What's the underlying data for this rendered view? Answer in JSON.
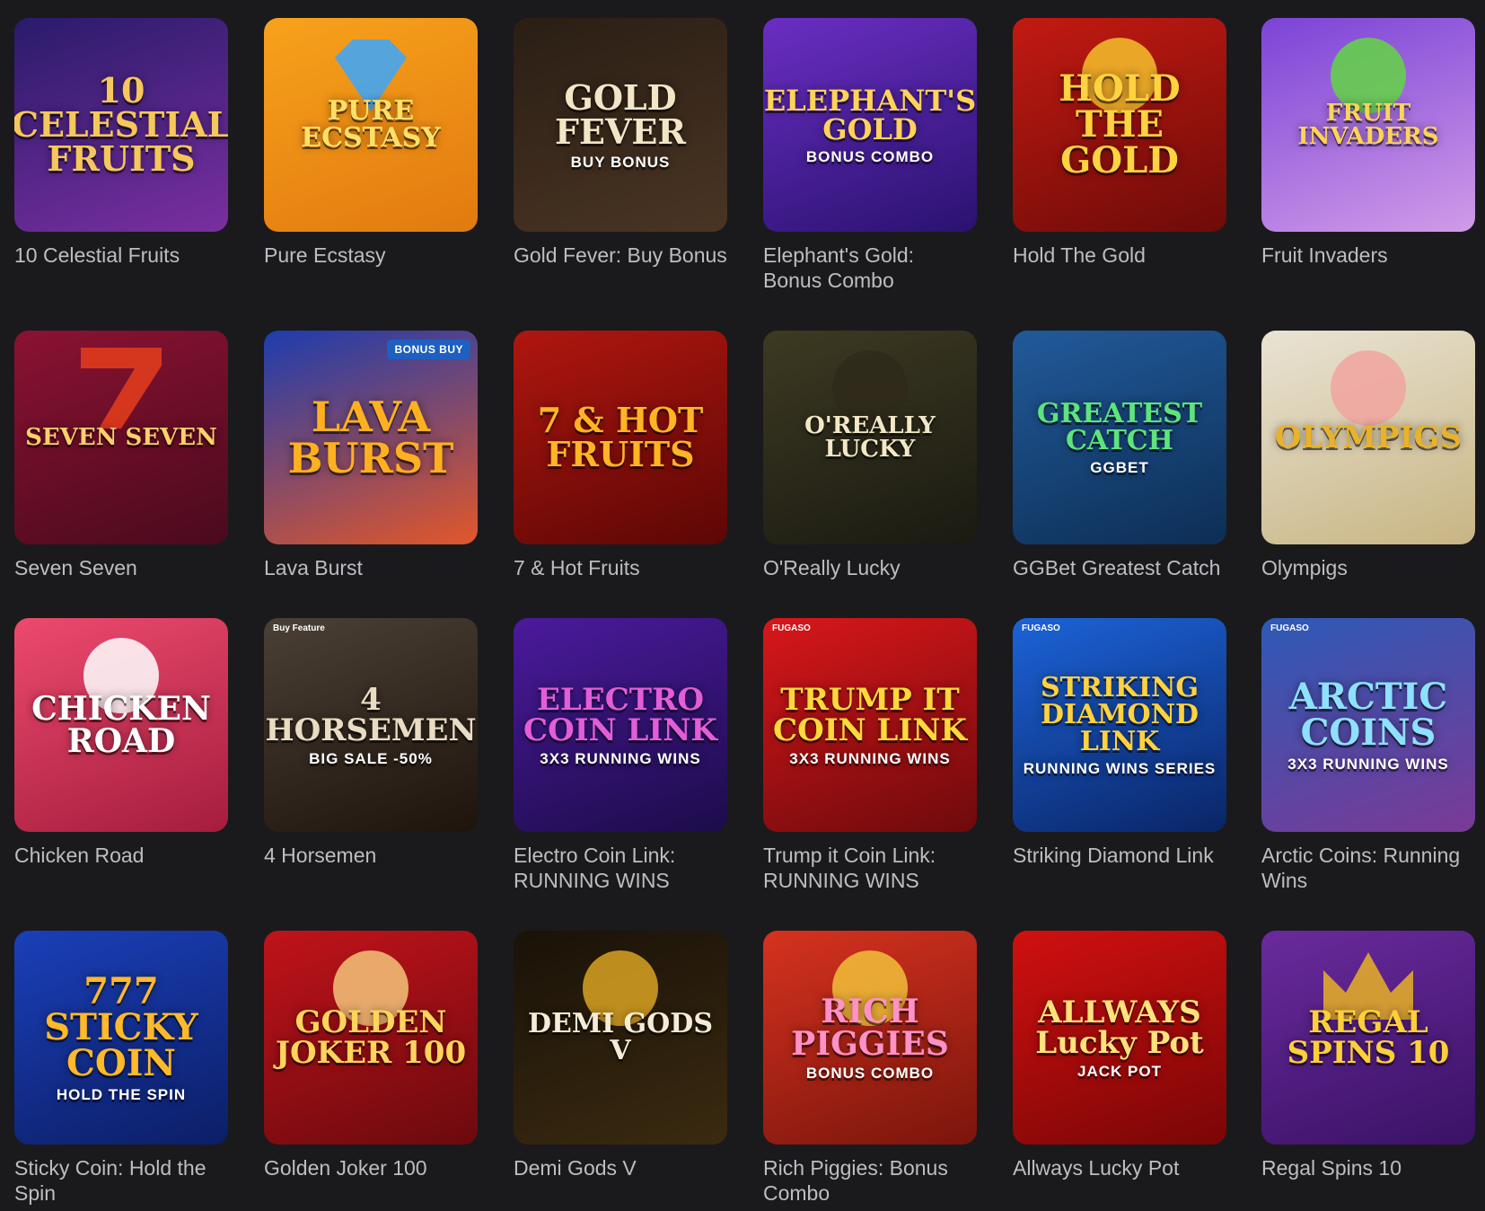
{
  "games": [
    {
      "name": "10 Celestial Fruits",
      "art_text": "10 CELESTIAL FRUITS",
      "bg": [
        "#2a1b6b",
        "#7a2fa0"
      ],
      "text_color": "#f6c75a",
      "art_size": 38
    },
    {
      "name": "Pure Ecstasy",
      "art_text": "PURE ECSTASY",
      "bg": [
        "#f7a21c",
        "#e27a0f"
      ],
      "text_color": "#ffe066",
      "art_size": 30,
      "icon": "diamond-icon",
      "icon_color": "#3aa7ff"
    },
    {
      "name": "Gold Fever: Buy Bonus",
      "art_text": "GOLD FEVER",
      "art_sub": "BUY BONUS",
      "bg": [
        "#2a1e14",
        "#4a3524"
      ],
      "text_color": "#f2e6c6",
      "art_size": 38
    },
    {
      "name": "Elephant's Gold: Bonus Combo",
      "art_text": "ELEPHANT'S GOLD",
      "art_sub": "BONUS COMBO",
      "bg": [
        "#6a2ec2",
        "#2a1270"
      ],
      "text_color": "#ffd25a",
      "art_size": 32
    },
    {
      "name": "Hold The Gold",
      "art_text": "HOLD THE GOLD",
      "bg": [
        "#c21a12",
        "#6e0b08"
      ],
      "text_color": "#ffd23f",
      "art_size": 40,
      "icon": "question-coin-icon",
      "icon_color": "#f5c02c"
    },
    {
      "name": "Fruit Invaders",
      "art_text": "FRUIT INVADERS",
      "bg": [
        "#7b43d6",
        "#d19be8"
      ],
      "text_color": "#ffd35a",
      "art_size": 26,
      "icon": "monster-icon",
      "icon_color": "#63d645"
    },
    {
      "name": "Seven Seven",
      "art_text": "SEVEN SEVEN",
      "bg": [
        "#8a1232",
        "#4a0a1d"
      ],
      "text_color": "#ffcf6b",
      "art_size": 26,
      "icon": "seven-icon",
      "icon_color": "#e63d1c"
    },
    {
      "name": "Lava Burst",
      "art_text": "LAVA BURST",
      "bg": [
        "#1d3cae",
        "#e2572a"
      ],
      "text_color": "#ffb020",
      "art_size": 46,
      "badge": "BONUS BUY"
    },
    {
      "name": "7 & Hot Fruits",
      "art_text": "7 & HOT FRUITS",
      "bg": [
        "#b0160f",
        "#5c0705"
      ],
      "text_color": "#ffb423",
      "art_size": 38
    },
    {
      "name": "O'Really Lucky",
      "art_text": "O'REALLY LUCKY",
      "bg": [
        "#3d3a22",
        "#1a1a12"
      ],
      "text_color": "#f3e8c6",
      "art_size": 26,
      "icon": "leprechaun-icon",
      "icon_color": "#2f2a1a"
    },
    {
      "name": "GGBet Greatest Catch",
      "art_text": "GREATEST CATCH",
      "art_sub": "GGBET",
      "bg": [
        "#215a9a",
        "#0d2e55"
      ],
      "text_color": "#5ee37d",
      "art_size": 30
    },
    {
      "name": "Olympigs",
      "art_text": "OLYMPIGS",
      "bg": [
        "#e9e3d4",
        "#c8b583"
      ],
      "text_color": "#e8b22b",
      "art_size": 34,
      "icon": "pig-icon",
      "icon_color": "#f2a5a0"
    },
    {
      "name": "Chicken Road",
      "art_text": "CHICKEN ROAD",
      "bg": [
        "#ec4a6d",
        "#a51d3e"
      ],
      "text_color": "#ffffff",
      "art_size": 36,
      "icon": "chicken-icon",
      "icon_color": "#ffffff"
    },
    {
      "name": "4 Horsemen",
      "art_text": "4 HORSEMEN",
      "art_sub": "BIG SALE -50%",
      "bg": [
        "#4a4036",
        "#1e140c"
      ],
      "text_color": "#e8dcc3",
      "art_size": 34,
      "provider": "Buy Feature"
    },
    {
      "name": "Electro Coin Link: RUNNING WINS",
      "art_text": "ELECTRO COIN LINK",
      "art_sub": "3X3 RUNNING WINS",
      "bg": [
        "#4b1a9c",
        "#1c0c4a"
      ],
      "text_color": "#e25ed8",
      "art_size": 34
    },
    {
      "name": "Trump it Coin Link: RUNNING WINS",
      "art_text": "TRUMP IT COIN LINK",
      "art_sub": "3X3 RUNNING WINS",
      "bg": [
        "#d8171a",
        "#6e0a0c"
      ],
      "text_color": "#ffd93a",
      "art_size": 34,
      "provider": "FUGASO"
    },
    {
      "name": "Striking Diamond Link",
      "art_text": "STRIKING DIAMOND LINK",
      "art_sub": "RUNNING WINS SERIES",
      "bg": [
        "#1c63d8",
        "#0a2566"
      ],
      "text_color": "#ffd23f",
      "art_size": 30,
      "provider": "FUGASO"
    },
    {
      "name": "Arctic Coins: Running Wins",
      "art_text": "ARCTIC COINS",
      "art_sub": "3X3 RUNNING WINS",
      "bg": [
        "#2d5ab6",
        "#7a3a96"
      ],
      "text_color": "#8ee0ff",
      "art_size": 40,
      "provider": "FUGASO"
    },
    {
      "name": "Sticky Coin: Hold the Spin",
      "art_text": "777 STICKY COIN",
      "art_sub": "HOLD THE SPIN",
      "bg": [
        "#1a3fb8",
        "#0c1e66"
      ],
      "text_color": "#ffb92a",
      "art_size": 40
    },
    {
      "name": "Golden Joker 100",
      "art_text": "GOLDEN JOKER 100",
      "bg": [
        "#c0131a",
        "#6b0a0e"
      ],
      "text_color": "#ffd45a",
      "art_size": 34,
      "icon": "joker-icon",
      "icon_color": "#f5c47a"
    },
    {
      "name": "Demi Gods V",
      "art_text": "DEMI GODS V",
      "bg": [
        "#1a1208",
        "#3a2a10"
      ],
      "text_color": "#f4ecd6",
      "art_size": 30,
      "icon": "gold-coin-icon",
      "icon_color": "#d9a322"
    },
    {
      "name": "Rich Piggies: Bonus Combo",
      "art_text": "RICH PIGGIES",
      "art_sub": "BONUS COMBO",
      "bg": [
        "#d6321f",
        "#7a150c"
      ],
      "text_color": "#ff90c8",
      "art_size": 36,
      "icon": "piggy-bank-icon",
      "icon_color": "#f2c03a"
    },
    {
      "name": "Allways Lucky Pot",
      "art_text": "ALLWAYS Lucky Pot",
      "art_sub": "JACK POT",
      "bg": [
        "#d01010",
        "#7a0606"
      ],
      "text_color": "#ffe27a",
      "art_size": 34
    },
    {
      "name": "Regal Spins 10",
      "art_text": "REGAL SPINS 10",
      "bg": [
        "#6a2a9c",
        "#3a1266"
      ],
      "text_color": "#ffcf3a",
      "art_size": 34,
      "icon": "crown-icon",
      "icon_color": "#e8b126"
    }
  ]
}
